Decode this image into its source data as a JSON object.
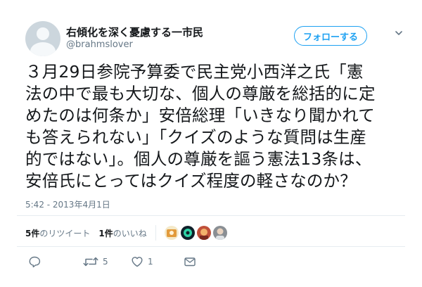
{
  "user": {
    "display_name": "右傾化を深く憂慮する一市民",
    "handle": "@brahmslover"
  },
  "follow_button_label": "フォローする",
  "tweet": {
    "lines": [
      "３月29日参院予算委で民主党小西洋之氏「憲",
      "法の中で最も大切な、個人の尊厳を総括的に定",
      "めたのは何条か」安倍総理「いきなり聞かれて",
      "も答えられない」「クイズのような質問は生産",
      "的ではない」。個人の尊厳を謳う憲法13条は、",
      "安倍氏にとってはクイズ程度の軽さなのか？"
    ],
    "timestamp": "5:42 - 2013年4月1日"
  },
  "stats": {
    "retweets_count": "5件",
    "retweets_label": "のリツイート",
    "likes_count": "1件",
    "likes_label": "のいいね"
  },
  "actions": {
    "reply_count": "",
    "retweet_count": "5",
    "like_count": "1"
  },
  "icons": {
    "follow_menu": "chevron-down-icon",
    "reply": "reply-icon",
    "retweet": "retweet-icon",
    "like": "heart-icon",
    "message": "mail-icon"
  },
  "colors": {
    "accent": "#1da1f2",
    "secondary_text": "#657786",
    "divider": "#e6ecf0"
  }
}
